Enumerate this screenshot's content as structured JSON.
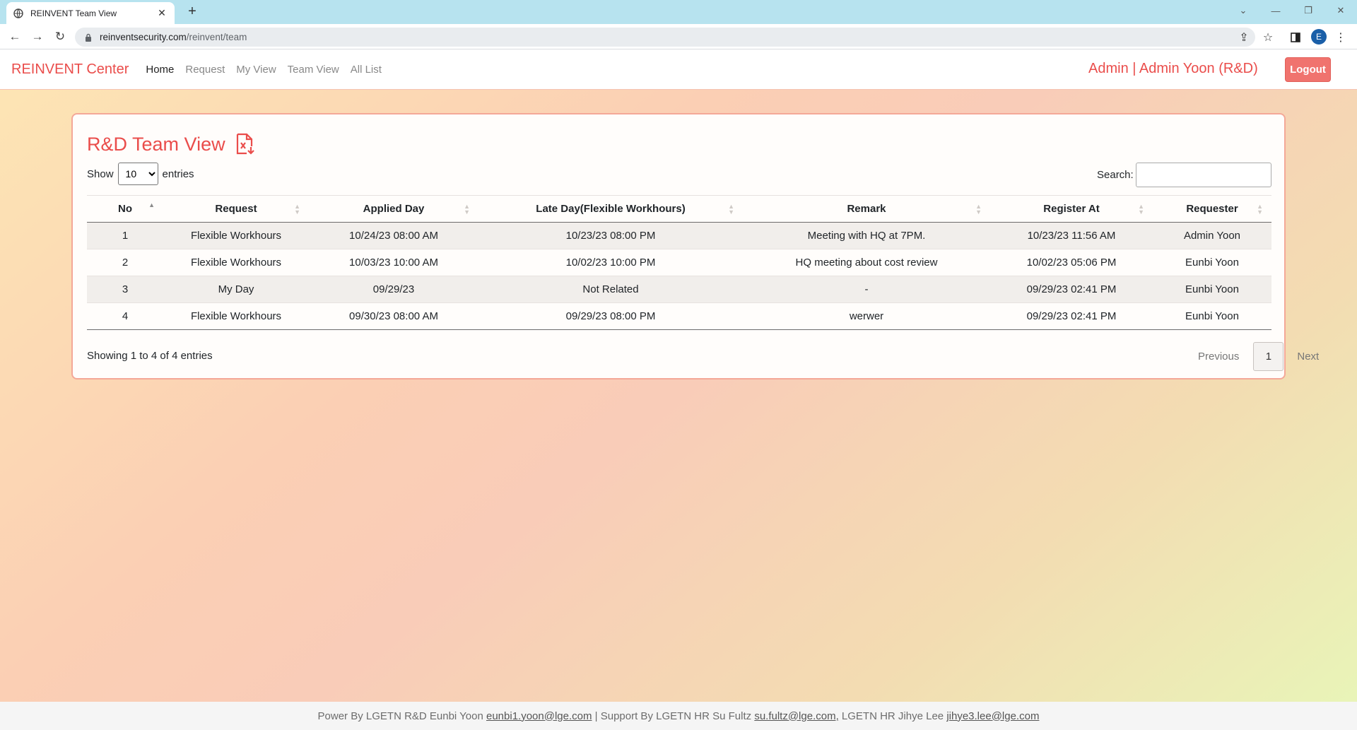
{
  "browser": {
    "tab_title": "REINVENT Team View",
    "new_tab": "+",
    "url_host": "reinventsecurity.com",
    "url_path": "/reinvent/team",
    "profile_initial": "E"
  },
  "navbar": {
    "brand": "REINVENT Center",
    "links": [
      "Home",
      "Request",
      "My View",
      "Team View",
      "All List"
    ],
    "user": "Admin | Admin Yoon (R&D)",
    "logout": "Logout"
  },
  "card": {
    "title": "R&D Team View",
    "show_label": "Show",
    "entries_label": "entries",
    "page_length": "10",
    "search_label": "Search:",
    "search_value": ""
  },
  "table": {
    "columns": [
      "No",
      "Request",
      "Applied Day",
      "Late Day(Flexible Workhours)",
      "Remark",
      "Register At",
      "Requester"
    ],
    "rows": [
      [
        "1",
        "Flexible Workhours",
        "10/24/23 08:00 AM",
        "10/23/23 08:00 PM",
        "Meeting with HQ at 7PM.",
        "10/23/23 11:56 AM",
        "Admin Yoon"
      ],
      [
        "2",
        "Flexible Workhours",
        "10/03/23 10:00 AM",
        "10/02/23 10:00 PM",
        "HQ meeting about cost review",
        "10/02/23 05:06 PM",
        "Eunbi Yoon"
      ],
      [
        "3",
        "My Day",
        "09/29/23",
        "Not Related",
        "-",
        "09/29/23 02:41 PM",
        "Eunbi Yoon"
      ],
      [
        "4",
        "Flexible Workhours",
        "09/30/23 08:00 AM",
        "09/29/23 08:00 PM",
        "werwer",
        "09/29/23 02:41 PM",
        "Eunbi Yoon"
      ]
    ]
  },
  "pagination": {
    "info": "Showing 1 to 4 of 4 entries",
    "previous": "Previous",
    "current_page": "1",
    "next": "Next"
  },
  "footer": {
    "part1": "Power By LGETN R&D Eunbi Yoon ",
    "email1": "eunbi1.yoon@lge.com",
    "part2": " | Support By LGETN HR Su Fultz ",
    "email2": "su.fultz@lge.com,",
    "part3": " LGETN HR Jihye Lee ",
    "email3": "jihye3.lee@lge.com"
  }
}
